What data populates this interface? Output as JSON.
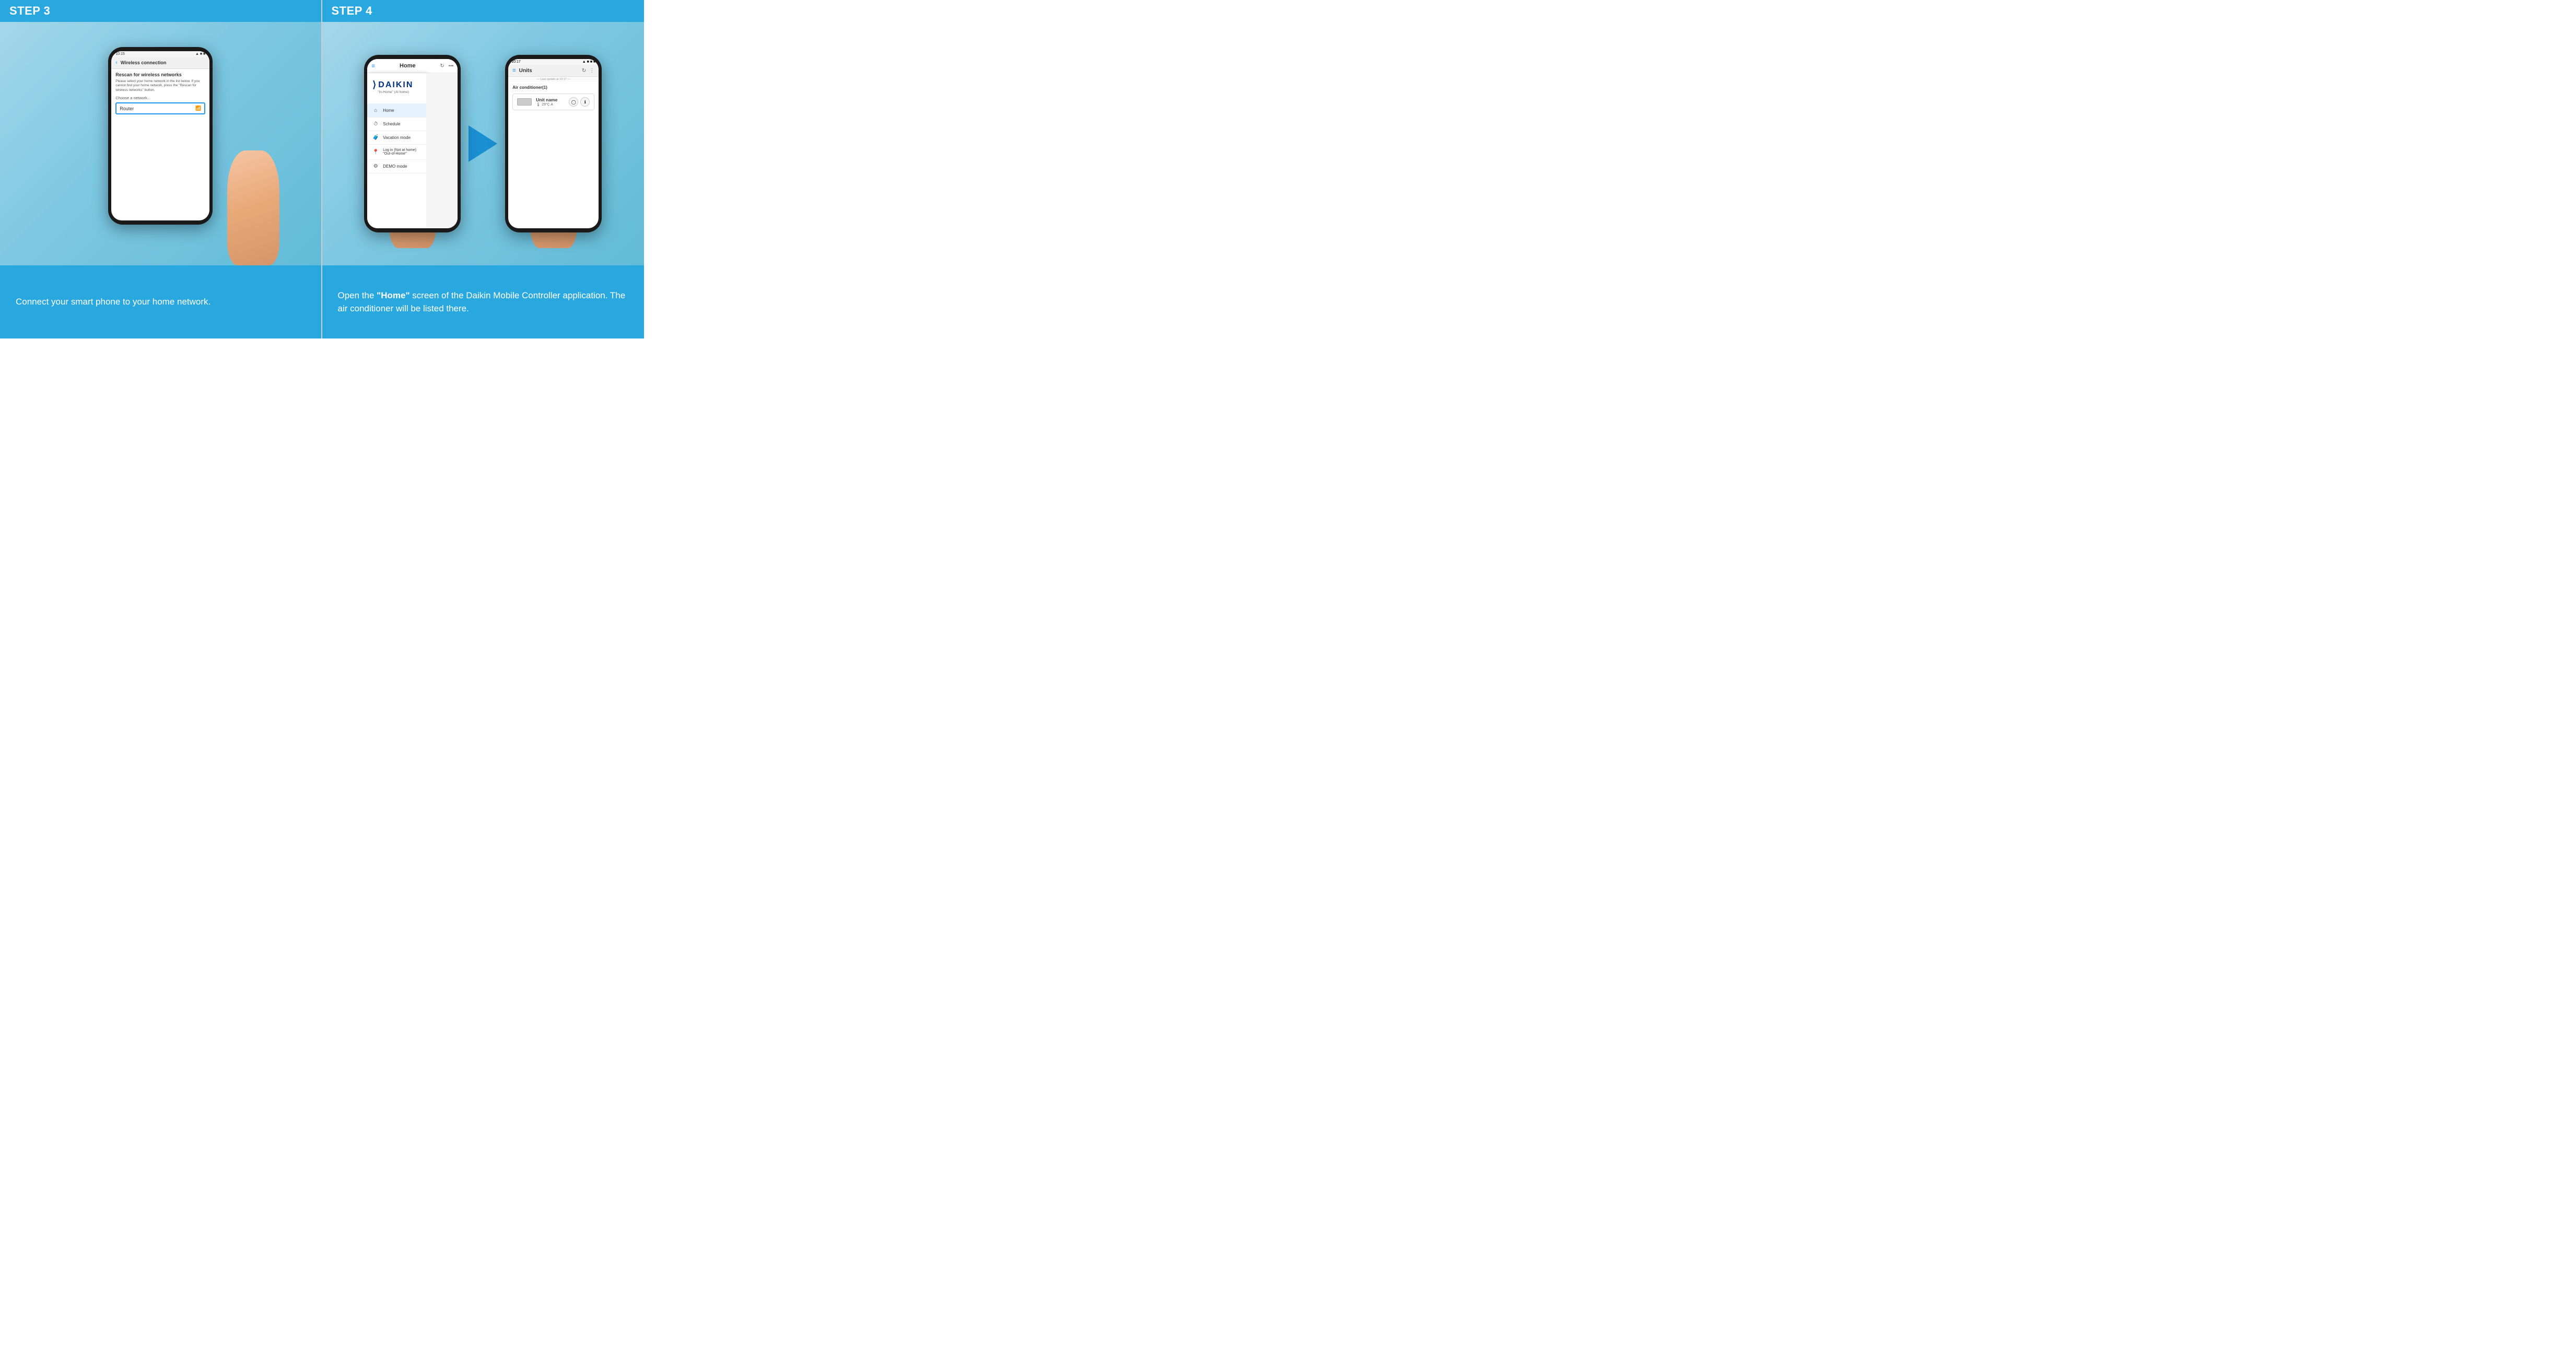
{
  "left": {
    "step_label": "STEP 3",
    "phone": {
      "status_time": "10:15",
      "nav_back": "‹",
      "nav_title": "Wireless connection",
      "rescan_title": "Rescan for wireless networks",
      "rescan_desc": "Please select your home network in the list below. If you cannot find your home network, press the \"Rescan for wireless networks\" button.",
      "choose_label": "Choose a network...",
      "network_name": "Router"
    },
    "description": "Connect your smart phone to your home network."
  },
  "right": {
    "step_label": "STEP 4",
    "phone4a": {
      "header_title": "Home",
      "daikin_logo": "DAIKIN",
      "subtitle": "\"In-Home\" (At home)",
      "menu_items": [
        {
          "icon": "🏠",
          "label": "Home",
          "active": true
        },
        {
          "icon": "🕐",
          "label": "Schedule",
          "active": false
        },
        {
          "icon": "🧳",
          "label": "Vacation mode",
          "active": false
        },
        {
          "icon": "📍",
          "label": "Log in (Not at home)\n\"Out-of-Home\"",
          "active": false
        },
        {
          "icon": "⚙",
          "label": "DEMO mode",
          "active": false
        }
      ]
    },
    "phone4b": {
      "status_time": "10:17",
      "nav_title": "Units",
      "last_update": "— Last update at 10:17 —",
      "section_title": "Air conditioner(1)",
      "unit": {
        "name": "Unit name",
        "temp": "29°C  A",
        "temp_icon": "🌡"
      }
    },
    "description_part1": "Open the ",
    "description_bold": "\"Home\"",
    "description_part2": "  screen of the Daikin Mobile Controller application. The air conditioner will be listed there."
  }
}
